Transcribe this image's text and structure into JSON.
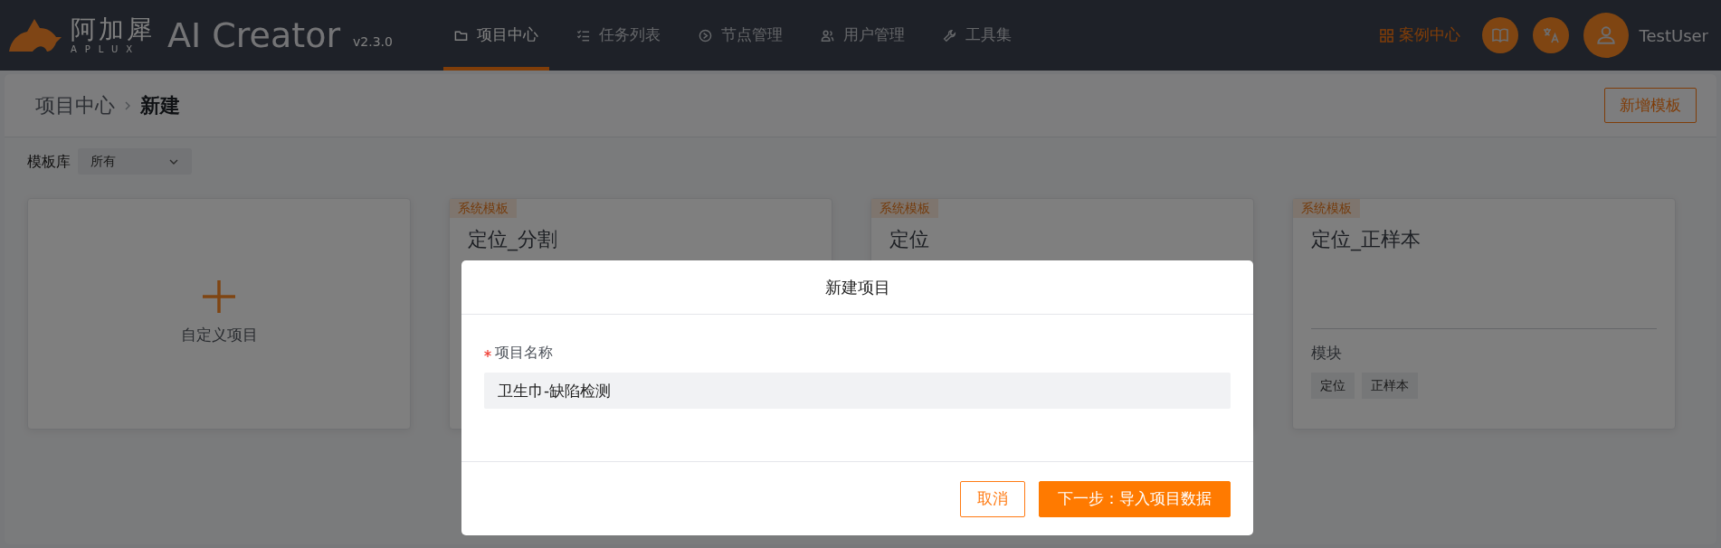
{
  "navbar": {
    "logo": {
      "name": "阿加犀",
      "sub": "APLUX",
      "product": "AI Creator",
      "version": "v2.3.0"
    },
    "nav_items": [
      {
        "label": "项目中心",
        "selected": true
      },
      {
        "label": "任务列表",
        "selected": false
      },
      {
        "label": "节点管理",
        "selected": false
      },
      {
        "label": "用户管理",
        "selected": false
      },
      {
        "label": "工具集",
        "selected": false
      }
    ],
    "case_center": "案例中心",
    "user": "TestUser"
  },
  "breadcrumb": [
    {
      "label": "项目中心",
      "current": false
    },
    {
      "label": "新建",
      "current": true
    }
  ],
  "add_template_button": "新增模板",
  "filter": {
    "label": "模板库",
    "value": "所有"
  },
  "cards": [
    {
      "kind": "custom",
      "label": "自定义项目"
    },
    {
      "kind": "template",
      "badge": "系统模板",
      "title": "定位_分割"
    },
    {
      "kind": "template",
      "badge": "系统模板",
      "title": "定位"
    },
    {
      "kind": "template",
      "badge": "系统模板",
      "title": "定位_正样本",
      "module_label": "模块",
      "tags": [
        "定位",
        "正样本"
      ]
    }
  ],
  "modal": {
    "title": "新建项目",
    "field": {
      "label": "项目名称",
      "required": true,
      "value": "卫生巾-缺陷检测"
    },
    "buttons": [
      {
        "label": "取消",
        "kind": "secondary"
      },
      {
        "label": "下一步：导入项目数据",
        "kind": "primary"
      }
    ]
  }
}
